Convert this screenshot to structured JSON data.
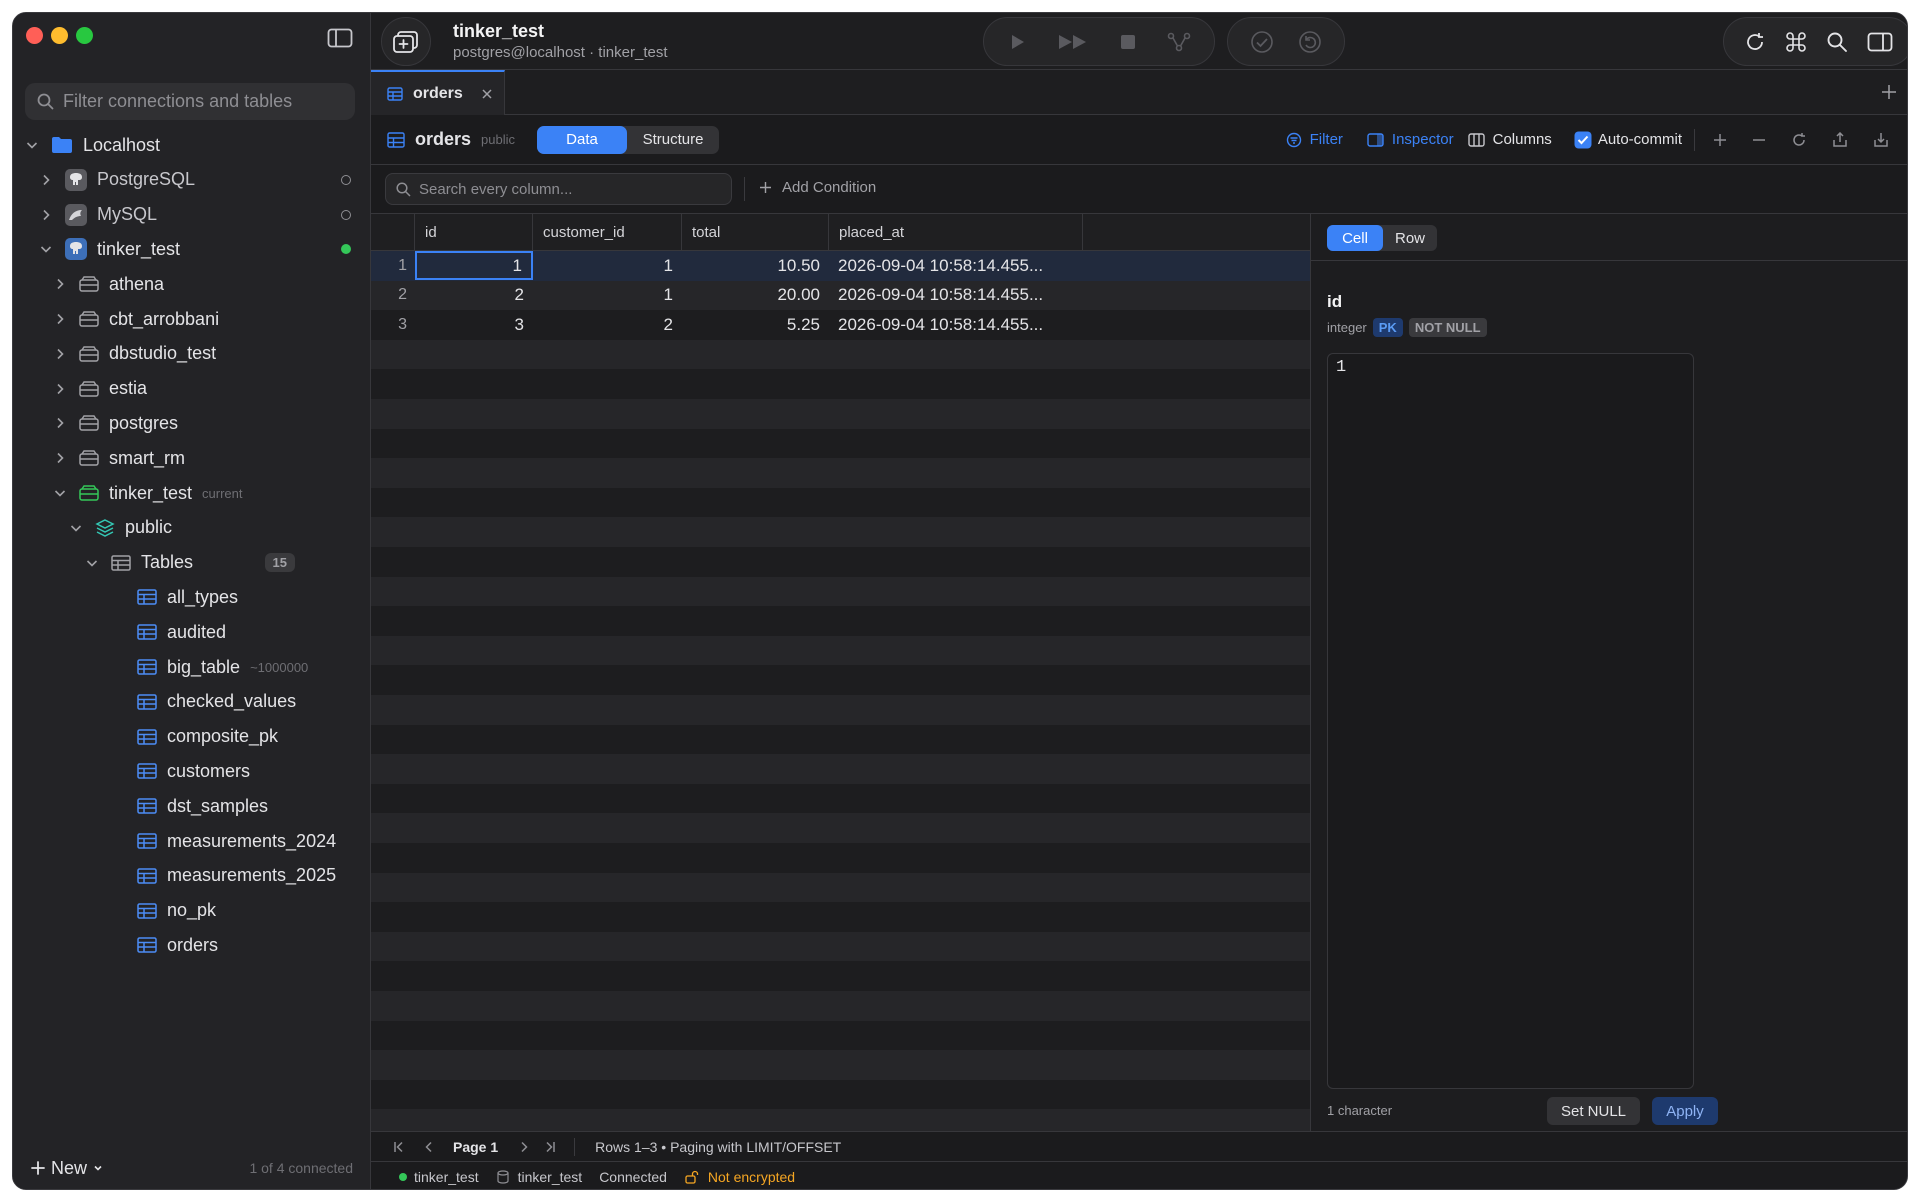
{
  "window": {
    "title": "tinker_test",
    "subtitle": "postgres@localhost · tinker_test"
  },
  "sidebar": {
    "search_placeholder": "Filter connections and tables",
    "root": "Localhost",
    "connections": [
      {
        "label": "PostgreSQL",
        "status": "idle"
      },
      {
        "label": "MySQL",
        "status": "idle"
      },
      {
        "label": "tinker_test",
        "status": "connected"
      }
    ],
    "databases": [
      "athena",
      "cbt_arrobbani",
      "dbstudio_test",
      "estia",
      "postgres",
      "smart_rm"
    ],
    "current_db": {
      "label": "tinker_test",
      "hint": "current"
    },
    "schema": "public",
    "tables_group": {
      "label": "Tables",
      "count": "15"
    },
    "tables": [
      {
        "label": "all_types",
        "hint": ""
      },
      {
        "label": "audited",
        "hint": ""
      },
      {
        "label": "big_table",
        "hint": "~1000000"
      },
      {
        "label": "checked_values",
        "hint": ""
      },
      {
        "label": "composite_pk",
        "hint": ""
      },
      {
        "label": "customers",
        "hint": ""
      },
      {
        "label": "dst_samples",
        "hint": ""
      },
      {
        "label": "measurements_2024",
        "hint": ""
      },
      {
        "label": "measurements_2025",
        "hint": ""
      },
      {
        "label": "no_pk",
        "hint": ""
      },
      {
        "label": "orders",
        "hint": ""
      }
    ],
    "new_label": "New",
    "connected_summary": "1 of 4 connected"
  },
  "tab": {
    "label": "orders"
  },
  "toolbar": {
    "table_name": "orders",
    "schema": "public",
    "view_data": "Data",
    "view_structure": "Structure",
    "filter": "Filter",
    "inspector": "Inspector",
    "columns": "Columns",
    "autocommit": "Auto-commit"
  },
  "filter": {
    "placeholder": "Search every column...",
    "add_condition": "Add Condition"
  },
  "grid": {
    "columns": [
      "id",
      "customer_id",
      "total",
      "placed_at"
    ],
    "rows": [
      {
        "num": "1",
        "id": "1",
        "customer_id": "1",
        "total": "10.50",
        "placed_at": "2026-09-04 10:58:14.455..."
      },
      {
        "num": "2",
        "id": "2",
        "customer_id": "1",
        "total": "20.00",
        "placed_at": "2026-09-04 10:58:14.455..."
      },
      {
        "num": "3",
        "id": "3",
        "customer_id": "2",
        "total": "5.25",
        "placed_at": "2026-09-04 10:58:14.455..."
      }
    ]
  },
  "inspector": {
    "tab_cell": "Cell",
    "tab_row": "Row",
    "field_name": "id",
    "field_type": "integer",
    "badge_pk": "PK",
    "badge_notnull": "NOT NULL",
    "value": "1",
    "char_count": "1 character",
    "set_null": "Set NULL",
    "apply": "Apply"
  },
  "pager": {
    "page": "Page 1",
    "info": "Rows 1–3 • Paging with LIMIT/OFFSET"
  },
  "status": {
    "connection": "tinker_test",
    "database": "tinker_test",
    "state": "Connected",
    "security": "Not encrypted"
  },
  "colors": {
    "accent": "#3b82f6",
    "connected": "#34c759",
    "warning": "#f5a623"
  }
}
